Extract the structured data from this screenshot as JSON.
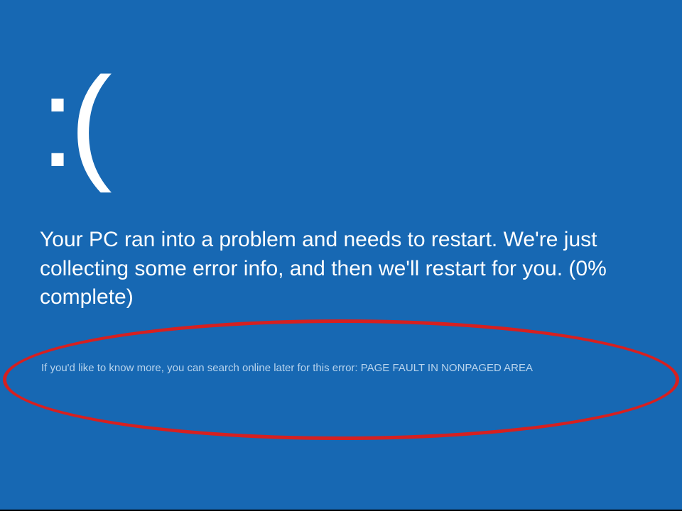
{
  "bsod": {
    "emoticon": ":(",
    "main_text": "Your PC ran into a problem and needs to restart. We're just collecting some error info, and then we'll restart for you. (0% complete)",
    "detail_text": "If you'd like to know more, you can search online later for this error: PAGE FAULT IN NONPAGED AREA",
    "percent_complete": 0,
    "error_code": "PAGE FAULT IN NONPAGED AREA"
  },
  "annotation": {
    "highlight_color": "#d62020"
  },
  "colors": {
    "background": "#1768b3",
    "text_primary": "#ffffff",
    "text_secondary": "#b8d4ed"
  }
}
